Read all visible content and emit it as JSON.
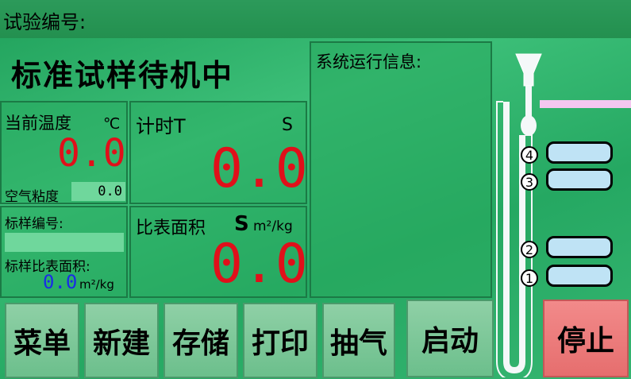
{
  "header": {
    "test_no_label": "试验编号:"
  },
  "status": {
    "title": "标准试样待机中"
  },
  "system_info": {
    "title": "系统运行信息:"
  },
  "temperature": {
    "label": "当前温度",
    "unit": "℃",
    "value": "0.0"
  },
  "air_viscosity": {
    "label": "空气粘度",
    "value": "0.0"
  },
  "timer": {
    "label": "计时T",
    "unit": "S",
    "value": "0.0"
  },
  "sample": {
    "no_label": "标样编号:",
    "no_value": "",
    "surface_label": "标样比表面积:",
    "surface_value": "0.0",
    "surface_unit": "m²/kg"
  },
  "specific_surface": {
    "label": "比表面积",
    "symbol": "S",
    "unit": "m²/kg",
    "value": "0.0"
  },
  "tube": {
    "markers": [
      "4",
      "3",
      "2",
      "1"
    ],
    "colors": {
      "slot": "#bfe3f5",
      "pipe": "#f4c7f0"
    }
  },
  "buttons": {
    "menu": "菜单",
    "new": "新建",
    "save": "存储",
    "print": "打印",
    "pump": "抽气",
    "start": "启动",
    "stop": "停止"
  },
  "colors": {
    "value_red": "#e0101a",
    "value_blue": "#1a2ce6",
    "stop_bg": "#ef7a7a"
  }
}
